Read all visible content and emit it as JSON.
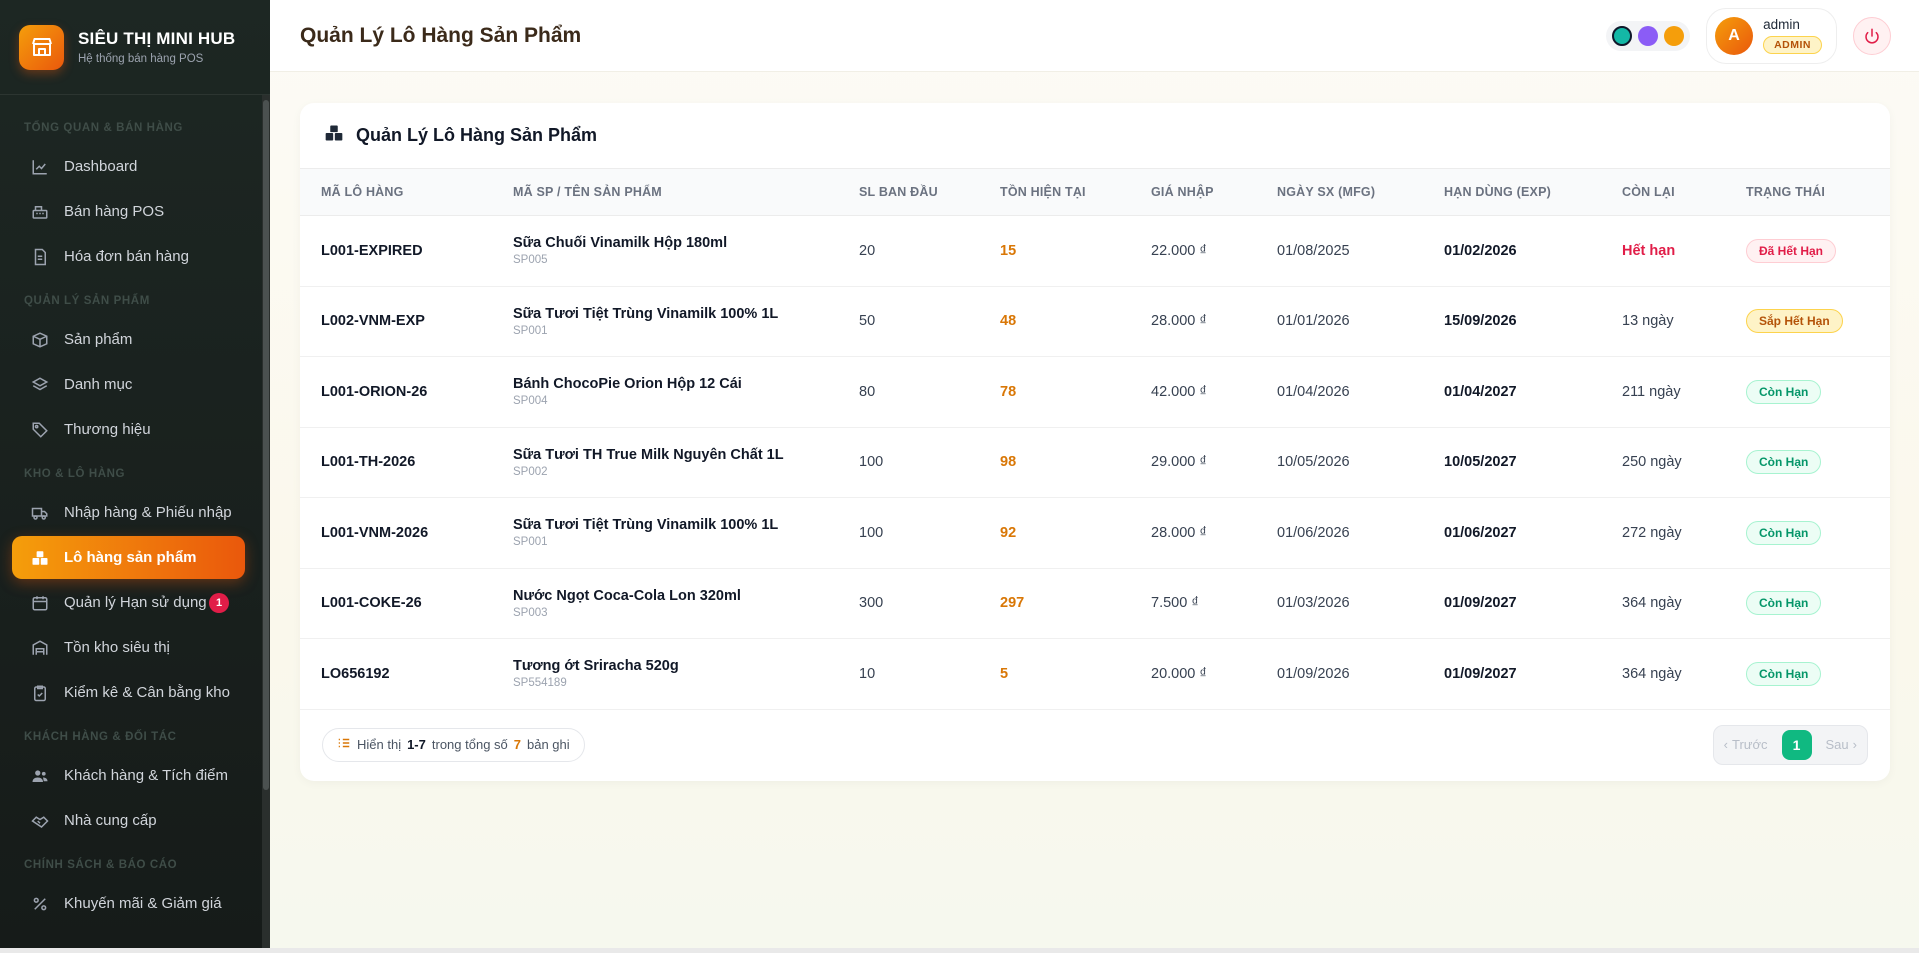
{
  "brand": {
    "title": "SIÊU THỊ MINI HUB",
    "subtitle": "Hệ thống bán hàng POS"
  },
  "sidebar": {
    "sections": [
      {
        "title": "TỔNG QUAN & BÁN HÀNG",
        "items": [
          {
            "label": "Dashboard",
            "icon": "chart-line-icon"
          },
          {
            "label": "Bán hàng POS",
            "icon": "cash-register-icon"
          },
          {
            "label": "Hóa đơn bán hàng",
            "icon": "invoice-icon"
          }
        ]
      },
      {
        "title": "QUẢN LÝ SẢN PHẨM",
        "items": [
          {
            "label": "Sản phẩm",
            "icon": "box-icon"
          },
          {
            "label": "Danh mục",
            "icon": "layers-icon"
          },
          {
            "label": "Thương hiệu",
            "icon": "tags-icon"
          }
        ]
      },
      {
        "title": "KHO & LÔ HÀNG",
        "items": [
          {
            "label": "Nhập hàng & Phiếu nhập",
            "icon": "truck-icon"
          },
          {
            "label": "Lô hàng sản phẩm",
            "icon": "boxes-icon",
            "active": true
          },
          {
            "label": "Quản lý Hạn sử dụng",
            "icon": "calendar-icon",
            "badge": "1"
          },
          {
            "label": "Tồn kho siêu thị",
            "icon": "warehouse-icon"
          },
          {
            "label": "Kiểm kê & Cân bằng kho",
            "icon": "clipboard-check-icon"
          }
        ]
      },
      {
        "title": "KHÁCH HÀNG & ĐỐI TÁC",
        "items": [
          {
            "label": "Khách hàng & Tích điểm",
            "icon": "users-icon"
          },
          {
            "label": "Nhà cung cấp",
            "icon": "handshake-icon"
          }
        ]
      },
      {
        "title": "CHÍNH SÁCH & BÁO CÁO",
        "items": [
          {
            "label": "Khuyến mãi & Giảm giá",
            "icon": "percent-icon"
          }
        ]
      }
    ]
  },
  "header": {
    "title": "Quản Lý Lô Hàng Sản Phẩm",
    "theme_colors": [
      "#14b8a6",
      "#8b5cf6",
      "#f59e0b"
    ],
    "user": {
      "initial": "A",
      "name": "admin",
      "role": "ADMIN"
    }
  },
  "card": {
    "title": "Quản Lý Lô Hàng Sản Phẩm",
    "columns": [
      "MÃ LÔ HÀNG",
      "MÃ SP / TÊN SẢN PHẨM",
      "SL BAN ĐẦU",
      "TỒN HIỆN TẠI",
      "GIÁ NHẬP",
      "NGÀY SX (MFG)",
      "HẠN DÙNG (EXP)",
      "CÒN LẠI",
      "TRẠNG THÁI"
    ],
    "rows": [
      {
        "lot": "L001-EXPIRED",
        "name": "Sữa Chuối Vinamilk Hộp 180ml",
        "code": "SP005",
        "initial": "20",
        "stock": "15",
        "price": "22.000 ₫",
        "mfg": "01/08/2025",
        "exp": "01/02/2026",
        "remaining": "Hết hạn",
        "status": "Đã Hết Hạn",
        "status_type": "expired"
      },
      {
        "lot": "L002-VNM-EXP",
        "name": "Sữa Tươi Tiệt Trùng Vinamilk 100% 1L",
        "code": "SP001",
        "initial": "50",
        "stock": "48",
        "price": "28.000 ₫",
        "mfg": "01/01/2026",
        "exp": "15/09/2026",
        "remaining": "13 ngày",
        "status": "Sắp Hết Hạn",
        "status_type": "soon"
      },
      {
        "lot": "L001-ORION-26",
        "name": "Bánh ChocoPie Orion Hộp 12 Cái",
        "code": "SP004",
        "initial": "80",
        "stock": "78",
        "price": "42.000 ₫",
        "mfg": "01/04/2026",
        "exp": "01/04/2027",
        "remaining": "211 ngày",
        "status": "Còn Hạn",
        "status_type": "ok"
      },
      {
        "lot": "L001-TH-2026",
        "name": "Sữa Tươi TH True Milk Nguyên Chất 1L",
        "code": "SP002",
        "initial": "100",
        "stock": "98",
        "price": "29.000 ₫",
        "mfg": "10/05/2026",
        "exp": "10/05/2027",
        "remaining": "250 ngày",
        "status": "Còn Hạn",
        "status_type": "ok"
      },
      {
        "lot": "L001-VNM-2026",
        "name": "Sữa Tươi Tiệt Trùng Vinamilk 100% 1L",
        "code": "SP001",
        "initial": "100",
        "stock": "92",
        "price": "28.000 ₫",
        "mfg": "01/06/2026",
        "exp": "01/06/2027",
        "remaining": "272 ngày",
        "status": "Còn Hạn",
        "status_type": "ok"
      },
      {
        "lot": "L001-COKE-26",
        "name": "Nước Ngọt Coca-Cola Lon 320ml",
        "code": "SP003",
        "initial": "300",
        "stock": "297",
        "price": "7.500 ₫",
        "mfg": "01/03/2026",
        "exp": "01/09/2027",
        "remaining": "364 ngày",
        "status": "Còn Hạn",
        "status_type": "ok"
      },
      {
        "lot": "LO656192",
        "name": "Tương ớt Sriracha 520g",
        "code": "SP554189",
        "initial": "10",
        "stock": "5",
        "price": "20.000 ₫",
        "mfg": "01/09/2026",
        "exp": "01/09/2027",
        "remaining": "364 ngày",
        "status": "Còn Hạn",
        "status_type": "ok"
      }
    ],
    "footer": {
      "showing_prefix": "Hiển thị",
      "range": "1-7",
      "total_prefix": "trong tổng số",
      "total": "7",
      "total_suffix": "bản ghi"
    },
    "pagination": {
      "prev": "Trước",
      "page": "1",
      "next": "Sau"
    }
  }
}
